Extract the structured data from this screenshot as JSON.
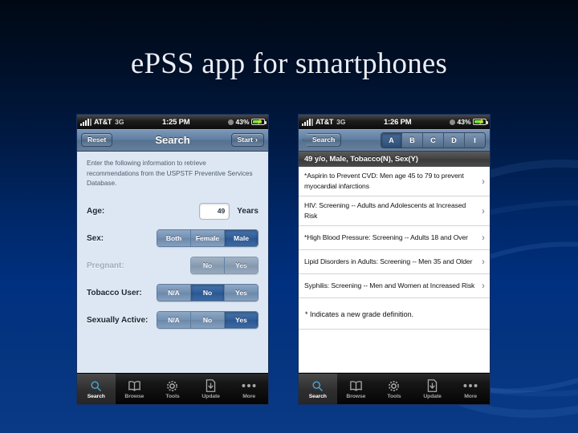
{
  "slide": {
    "title": "e-PSS app for smartphones",
    "title_display": "ePSS app for smartphones"
  },
  "phone_left": {
    "status_bar": {
      "carrier": "AT&T",
      "network": "3G",
      "time": "1:25 PM",
      "battery_percent": "43%",
      "signal_icon": "signal-bars-icon",
      "lock_icon": "rotation-lock-icon",
      "battery_icon": "battery-charging-icon"
    },
    "nav": {
      "left_button": "Reset",
      "title": "Search",
      "right_button": "Start",
      "right_button_chevron": "›"
    },
    "intro_text": "Enter the following information to retrieve recommendations from the USPSTF Preventive Services Database.",
    "fields": [
      {
        "label": "Age:",
        "type": "number",
        "value": "49",
        "units": "Years"
      },
      {
        "label": "Sex:",
        "type": "segmented",
        "disabled": false,
        "options": [
          "Both",
          "Female",
          "Male"
        ],
        "selected": "Male"
      },
      {
        "label": "Pregnant:",
        "type": "segmented",
        "disabled": true,
        "options": [
          "No",
          "Yes"
        ],
        "selected": ""
      },
      {
        "label": "Tobacco User:",
        "type": "segmented",
        "disabled": false,
        "options": [
          "N/A",
          "No",
          "Yes"
        ],
        "selected": "No"
      },
      {
        "label": "Sexually Active:",
        "type": "segmented",
        "disabled": false,
        "options": [
          "N/A",
          "No",
          "Yes"
        ],
        "selected": "Yes"
      }
    ],
    "tabs": [
      {
        "label": "Search",
        "icon": "magnifier-icon",
        "selected": true
      },
      {
        "label": "Browse",
        "icon": "book-icon",
        "selected": false
      },
      {
        "label": "Tools",
        "icon": "gear-icon",
        "selected": false
      },
      {
        "label": "Update",
        "icon": "download-document-icon",
        "selected": false
      },
      {
        "label": "More",
        "icon": "ellipsis-icon",
        "selected": false
      }
    ]
  },
  "phone_right": {
    "status_bar": {
      "carrier": "AT&T",
      "network": "3G",
      "time": "1:26 PM",
      "battery_percent": "43%",
      "signal_icon": "signal-bars-icon",
      "lock_icon": "rotation-lock-icon",
      "battery_icon": "battery-charging-icon"
    },
    "nav": {
      "back_button": "Search",
      "grade_filters": [
        "A",
        "B",
        "C",
        "D",
        "I"
      ],
      "selected_grade": "A"
    },
    "section_header": "49 y/o, Male, Tobacco(N), Sex(Y)",
    "results": [
      "*Aspirin to Prevent CVD: Men age 45 to 79 to prevent myocardial infarctions",
      "HIV: Screening -- Adults and Adolescents at Increased Risk",
      "*High Blood Pressure: Screening -- Adults 18 and Over",
      "Lipid Disorders in Adults: Screening -- Men 35 and Older",
      "Syphilis: Screening -- Men and Women at Increased Risk"
    ],
    "footnote": "* Indicates a new grade definition.",
    "disclosure_glyph": "›",
    "tabs": [
      {
        "label": "Search",
        "icon": "magnifier-icon",
        "selected": true
      },
      {
        "label": "Browse",
        "icon": "book-icon",
        "selected": false
      },
      {
        "label": "Tools",
        "icon": "gear-icon",
        "selected": false
      },
      {
        "label": "Update",
        "icon": "download-document-icon",
        "selected": false
      },
      {
        "label": "More",
        "icon": "ellipsis-icon",
        "selected": false
      }
    ]
  },
  "colors": {
    "background_top": "#000814",
    "background_bottom": "#0a3a86",
    "title_text": "#e9eef7",
    "form_background": "#dce7f3",
    "selected_segment": "#2f5d99",
    "tabbar_background": "#0a0a0a",
    "tab_selected_accent": "#4aa8d8",
    "section_header": "#414141"
  }
}
